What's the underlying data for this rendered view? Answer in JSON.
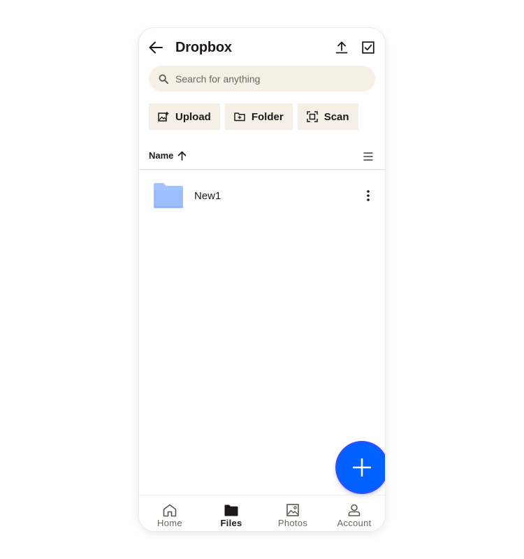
{
  "app": {
    "title": "Dropbox"
  },
  "search": {
    "placeholder": "Search for anything"
  },
  "actions": [
    {
      "label": "Upload",
      "icon": "upload-image-icon"
    },
    {
      "label": "Folder",
      "icon": "new-folder-icon"
    },
    {
      "label": "Scan",
      "icon": "scan-icon"
    }
  ],
  "sort": {
    "label": "Name",
    "direction": "ascending"
  },
  "files": [
    {
      "name": "New1",
      "type": "folder",
      "icon": "folder-icon"
    }
  ],
  "bottom_nav": [
    {
      "label": "Home",
      "icon": "home-icon",
      "active": false
    },
    {
      "label": "Files",
      "icon": "folder-filled-icon",
      "active": true
    },
    {
      "label": "Photos",
      "icon": "photo-icon",
      "active": false
    },
    {
      "label": "Account",
      "icon": "person-icon",
      "active": false
    }
  ],
  "colors": {
    "accent": "#0061fe",
    "chip_bg": "#f5efe6",
    "folder": "#a3c3ff"
  }
}
